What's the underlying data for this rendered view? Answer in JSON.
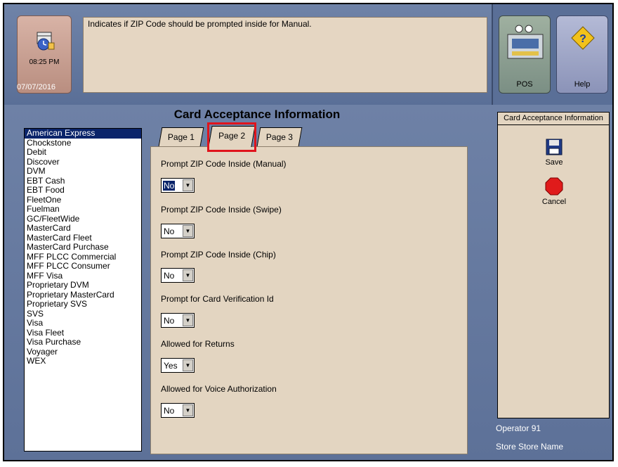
{
  "header": {
    "time": "08:25 PM",
    "date": "07/07/2016",
    "message": "Indicates if ZIP Code should be prompted inside for Manual.",
    "pos_label": "POS",
    "help_label": "Help"
  },
  "title": "Card Acceptance Information",
  "cards": [
    "American Express",
    "Chockstone",
    "Debit",
    "Discover",
    "DVM",
    "EBT Cash",
    "EBT Food",
    "FleetOne",
    "Fuelman",
    "GC/FleetWide",
    "MasterCard",
    "MasterCard Fleet",
    "MasterCard Purchase",
    "MFF PLCC Commercial",
    "MFF PLCC Consumer",
    "MFF Visa",
    "Proprietary DVM",
    "Proprietary MasterCard",
    "Proprietary SVS",
    "SVS",
    "Visa",
    "Visa Fleet",
    "Visa Purchase",
    "Voyager",
    "WEX"
  ],
  "selected_card": "American Express",
  "tabs": [
    "Page 1",
    "Page 2",
    "Page 3"
  ],
  "active_tab": "Page 2",
  "fields": [
    {
      "label": "Prompt ZIP Code Inside (Manual)",
      "value": "No"
    },
    {
      "label": "Prompt ZIP Code Inside (Swipe)",
      "value": "No"
    },
    {
      "label": "Prompt ZIP Code Inside (Chip)",
      "value": "No"
    },
    {
      "label": "Prompt for Card Verification Id",
      "value": "No"
    },
    {
      "label": "Allowed for Returns",
      "value": "Yes"
    },
    {
      "label": "Allowed for Voice Authorization",
      "value": "No"
    }
  ],
  "side_panel": {
    "title": "Card Acceptance Information",
    "save_label": "Save",
    "cancel_label": "Cancel"
  },
  "footer": {
    "operator": "Operator 91",
    "store": "Store Store Name"
  },
  "colors": {
    "highlight": "#e0141c",
    "selection": "#0a246a"
  }
}
